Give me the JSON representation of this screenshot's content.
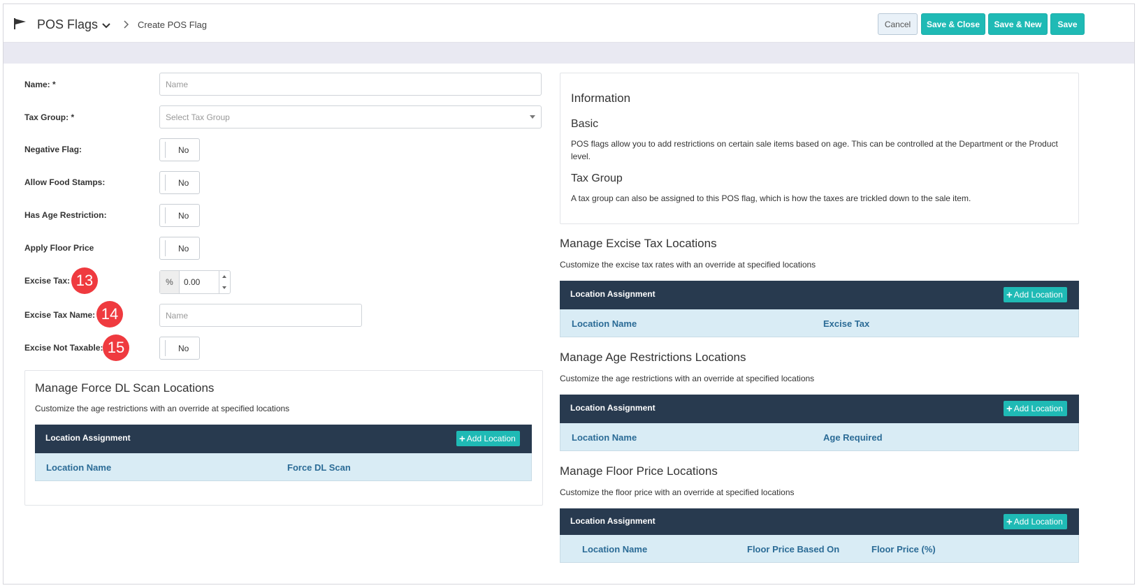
{
  "header": {
    "module_title": "POS Flags",
    "breadcrumb": "Create POS Flag",
    "buttons": {
      "cancel": "Cancel",
      "save_close": "Save & Close",
      "save_new": "Save & New",
      "save": "Save"
    }
  },
  "form": {
    "name": {
      "label": "Name: *",
      "placeholder": "Name"
    },
    "tax_group": {
      "label": "Tax Group: *",
      "placeholder": "Select Tax Group"
    },
    "negative_flag": {
      "label": "Negative Flag:",
      "value": "No"
    },
    "allow_food_stamps": {
      "label": "Allow Food Stamps:",
      "value": "No"
    },
    "has_age_restriction": {
      "label": "Has Age Restriction:",
      "value": "No"
    },
    "apply_floor_price": {
      "label": "Apply Floor Price",
      "value": "No"
    },
    "excise_tax": {
      "label": "Excise Tax:",
      "prefix": "%",
      "value": "0.00"
    },
    "excise_tax_name": {
      "label": "Excise Tax Name:",
      "placeholder": "Name"
    },
    "excise_not_taxable": {
      "label": "Excise Not Taxable:",
      "value": "No"
    }
  },
  "badges": [
    "13",
    "14",
    "15"
  ],
  "force_dl": {
    "title": "Manage Force DL Scan Locations",
    "subtitle": "Customize the age restrictions with an override at specified locations",
    "grid_title": "Location Assignment",
    "add_label": "Add Location",
    "columns": [
      "Location Name",
      "Force DL Scan"
    ]
  },
  "info": {
    "title": "Information",
    "basic_title": "Basic",
    "basic_text": "POS flags allow you to add restrictions on certain sale items based on age. This can be controlled at the Department or the Product level.",
    "tax_title": "Tax Group",
    "tax_text": "A tax group can also be assigned to this POS flag, which is how the taxes are trickled down to the sale item."
  },
  "excise_locations": {
    "title": "Manage Excise Tax Locations",
    "subtitle": "Customize the excise tax rates with an override at specified locations",
    "grid_title": "Location Assignment",
    "add_label": "Add Location",
    "columns": [
      "Location Name",
      "Excise Tax"
    ]
  },
  "age_locations": {
    "title": "Manage Age Restrictions Locations",
    "subtitle": "Customize the age restrictions with an override at specified locations",
    "grid_title": "Location Assignment",
    "add_label": "Add Location",
    "columns": [
      "Location Name",
      "Age Required"
    ]
  },
  "floor_locations": {
    "title": "Manage Floor Price Locations",
    "subtitle": "Customize the floor price with an override at specified locations",
    "grid_title": "Location Assignment",
    "add_label": "Add Location",
    "columns": [
      "Location Name",
      "Floor Price Based On",
      "Floor Price (%)"
    ]
  },
  "colors": {
    "accent": "#1fbab5",
    "grid_header": "#283a4f",
    "grid_columns_bg": "#d9ecf5",
    "badge": "#ef3a3f"
  }
}
